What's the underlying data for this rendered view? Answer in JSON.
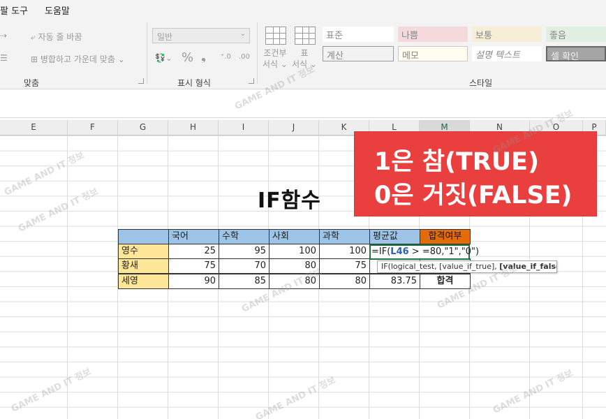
{
  "menubar": {
    "items": [
      "팔 도구",
      "도움말"
    ]
  },
  "ribbon": {
    "alignment": {
      "wrap_text": "자동 줄 바꿈",
      "merge_center": "병합하고 가운데 맞춤",
      "group_label": "맞춤"
    },
    "number": {
      "format_value": "일반",
      "percent_symbol": "%",
      "comma_symbol": "❟",
      "group_label": "표시 형식"
    },
    "styles": {
      "conditional_format": [
        "조건부",
        "서식"
      ],
      "format_table": [
        "표",
        "서식"
      ],
      "cells": [
        {
          "label": "표준",
          "bg": "#ffffff"
        },
        {
          "label": "나쁨",
          "bg": "#ffc7ce"
        },
        {
          "label": "보통",
          "bg": "#ffeb9c"
        },
        {
          "label": "좋음",
          "bg": "#c6efce"
        },
        {
          "label": "계산",
          "bg": "#f2f2f2"
        },
        {
          "label": "메모",
          "bg": "#ffffcc"
        },
        {
          "label": "설명 텍스트",
          "bg": "#ffffff"
        },
        {
          "label": "셀 확인",
          "bg": "#a5a5a5"
        }
      ],
      "group_label": "스타일"
    }
  },
  "columns": [
    "E",
    "F",
    "G",
    "H",
    "I",
    "J",
    "K",
    "L",
    "M",
    "N",
    "O",
    "P"
  ],
  "sheet": {
    "title": "IF함수",
    "headers": [
      "국어",
      "수학",
      "사회",
      "과학",
      "평균값",
      "합격여부"
    ],
    "rows": [
      {
        "name": "영수",
        "scores": [
          "25",
          "95",
          "100",
          "100"
        ],
        "avg": "",
        "result": ""
      },
      {
        "name": "황새",
        "scores": [
          "75",
          "70",
          "80",
          "75"
        ],
        "avg": "",
        "result": ""
      },
      {
        "name": "세영",
        "scores": [
          "90",
          "85",
          "80",
          "80"
        ],
        "avg": "83.75",
        "result": "합격"
      }
    ],
    "formula": {
      "prefix": "=IF(",
      "ref": "L46",
      "rest": " > =80,\"1\",\"0\")"
    },
    "tooltip": {
      "text": "IF(logical_test, [value_if_true], ",
      "bold": "[value_if_false]",
      "end": ")"
    }
  },
  "overlay": {
    "line1": "1은 참(TRUE)",
    "line2": "0은 거짓(FALSE)",
    "color": "#ea3f3f"
  },
  "watermark": "GAME AND IT 정보 창고",
  "colors": {
    "header_blue": "#9dc3e6",
    "header_orange": "#e36c09",
    "name_yellow": "#ffe699",
    "select_green": "#217346"
  }
}
